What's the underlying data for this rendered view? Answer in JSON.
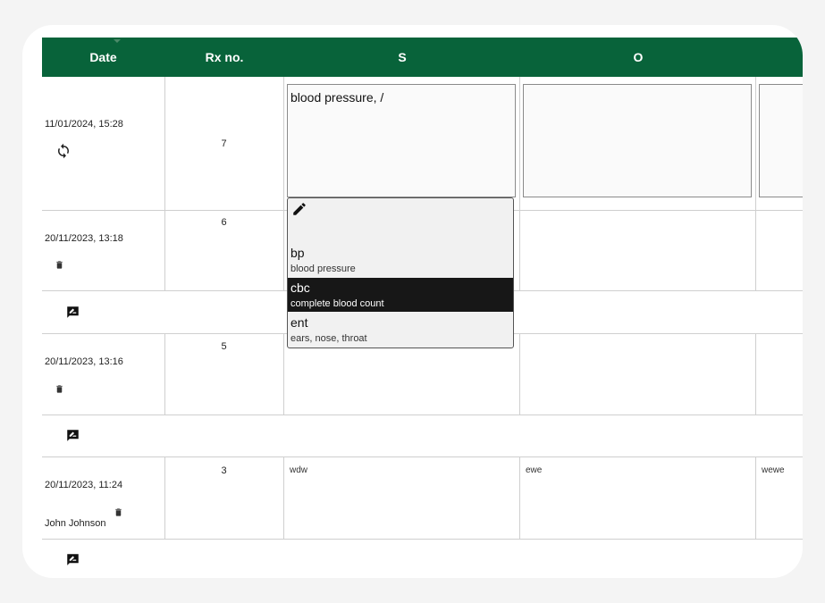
{
  "table": {
    "headers": {
      "date": "Date",
      "rx": "Rx no.",
      "s": "S",
      "o": "O"
    },
    "rows": [
      {
        "date": "11/01/2024, 15:28",
        "rx": "7",
        "s_value": "blood pressure, /",
        "o_value": ""
      },
      {
        "date": "20/11/2023, 13:18",
        "rx": "6"
      },
      {
        "date": "20/11/2023, 13:16",
        "rx": "5"
      },
      {
        "date": "20/11/2023, 11:24",
        "rx": "3",
        "author": "John Johnson",
        "s": "wdw",
        "o": "ewe",
        "next": "wewe"
      }
    ]
  },
  "autocomplete": {
    "items": [
      {
        "abbr": "bp",
        "desc": "blood pressure"
      },
      {
        "abbr": "cbc",
        "desc": "complete blood count",
        "selected": true
      },
      {
        "abbr": "ent",
        "desc": "ears, nose, throat"
      }
    ]
  },
  "icons": {
    "sync": "sync-icon",
    "delete": "trash-icon",
    "comment": "comment-edit-icon",
    "edit": "pencil-icon"
  },
  "colors": {
    "header_bg": "#08633a",
    "selected_bg": "#171717"
  }
}
